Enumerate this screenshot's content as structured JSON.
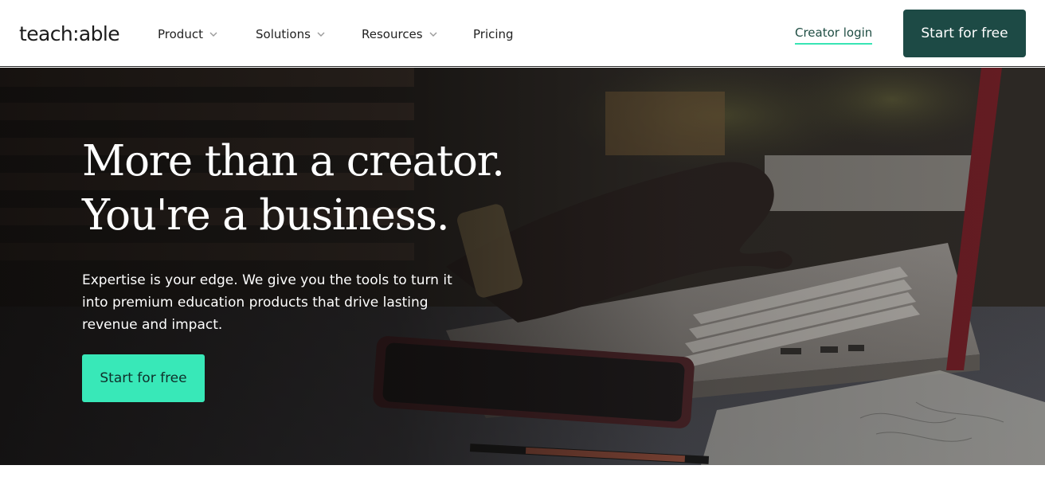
{
  "header": {
    "logo": "teach:able",
    "nav": [
      {
        "label": "Product",
        "has_dropdown": true,
        "icon": "chevron-down-icon"
      },
      {
        "label": "Solutions",
        "has_dropdown": true,
        "icon": "chevron-down-icon"
      },
      {
        "label": "Resources",
        "has_dropdown": true,
        "icon": "chevron-down-icon"
      },
      {
        "label": "Pricing",
        "has_dropdown": false
      }
    ],
    "creator_login": "Creator login",
    "cta": "Start for free"
  },
  "hero": {
    "headline_line1": "More than a creator.",
    "headline_line2": "You're a business.",
    "subtext": "Expertise is your edge. We give you the tools to turn it into premium education products that drive lasting revenue and impact.",
    "cta": "Start for free",
    "background": "photo-hands-typing-on-laptop"
  },
  "colors": {
    "brand_dark": "#1d4a45",
    "accent_mint": "#38e8b8",
    "text_dark": "#1b1b1b"
  }
}
